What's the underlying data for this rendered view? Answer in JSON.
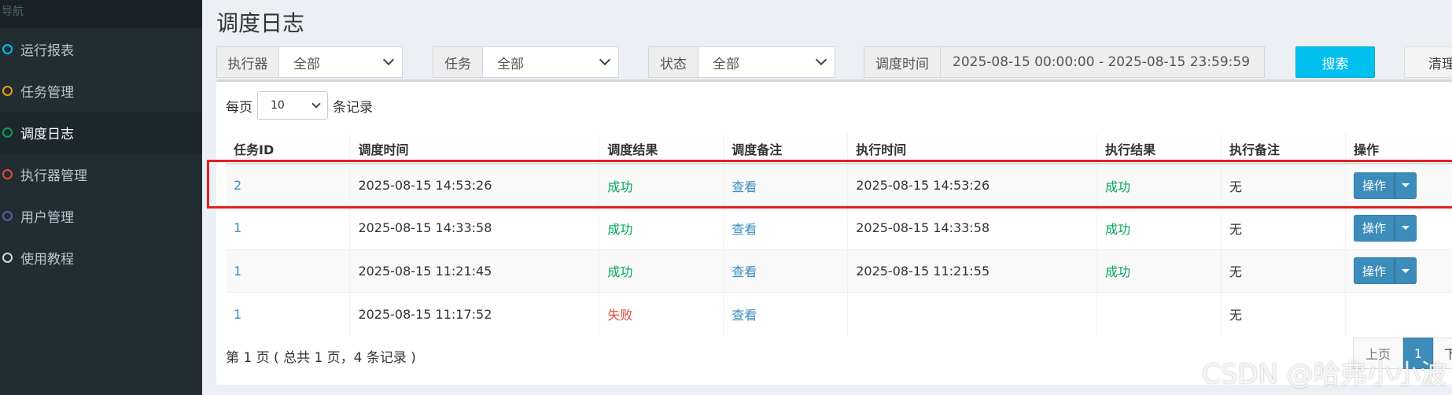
{
  "sidebar": {
    "header": "导航",
    "items": [
      {
        "label": "运行报表",
        "color": "#00c0ef"
      },
      {
        "label": "任务管理",
        "color": "#f39c12"
      },
      {
        "label": "调度日志",
        "color": "#00a65a"
      },
      {
        "label": "执行器管理",
        "color": "#dd4b39"
      },
      {
        "label": "用户管理",
        "color": "#605ca8"
      },
      {
        "label": "使用教程",
        "color": "#d2d6de"
      }
    ],
    "active_index": 2
  },
  "page_title": "调度日志",
  "filters": {
    "executor_label": "执行器",
    "executor_value": "全部",
    "job_label": "任务",
    "job_value": "全部",
    "status_label": "状态",
    "status_value": "全部",
    "time_label": "调度时间",
    "time_value": "2025-08-15 00:00:00 - 2025-08-15 23:59:59"
  },
  "buttons": {
    "search": "搜索",
    "clear": "清理"
  },
  "table": {
    "per_page_prefix": "每页",
    "per_page_value": "10",
    "per_page_suffix": "条记录",
    "headers": [
      "任务ID",
      "调度时间",
      "调度结果",
      "调度备注",
      "执行时间",
      "执行结果",
      "执行备注",
      "操作"
    ],
    "rows": [
      {
        "job_id": "2",
        "trigger_time": "2025-08-15 14:53:26",
        "trigger_result": "成功",
        "trigger_note": "查看",
        "handle_time": "2025-08-15 14:53:26",
        "handle_result": "成功",
        "handle_note": "无",
        "op": "操作"
      },
      {
        "job_id": "1",
        "trigger_time": "2025-08-15 14:33:58",
        "trigger_result": "成功",
        "trigger_note": "查看",
        "handle_time": "2025-08-15 14:33:58",
        "handle_result": "成功",
        "handle_note": "无",
        "op": "操作"
      },
      {
        "job_id": "1",
        "trigger_time": "2025-08-15 11:21:45",
        "trigger_result": "成功",
        "trigger_note": "查看",
        "handle_time": "2025-08-15 11:21:55",
        "handle_result": "成功",
        "handle_note": "无",
        "op": "操作"
      },
      {
        "job_id": "1",
        "trigger_time": "2025-08-15 11:17:52",
        "trigger_result": "失败",
        "trigger_note": "查看",
        "handle_time": "",
        "handle_result": "",
        "handle_note": "无",
        "op": ""
      }
    ],
    "info": "第 1 页 ( 总共 1 页，4 条记录 )"
  },
  "pagination": {
    "prev": "上页",
    "current": "1",
    "next": "下页"
  },
  "watermark": "CSDN @哈弗小小波"
}
